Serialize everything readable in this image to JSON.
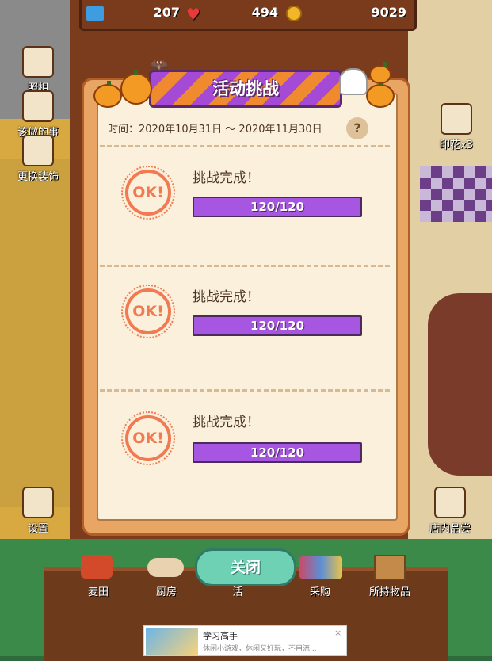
{
  "topbar": {
    "tickets": "207",
    "hearts": "494",
    "coins": "9029"
  },
  "left_menu": {
    "photo": "照相",
    "todo": "该做的事",
    "decor": "更换装饰",
    "settings": "设置"
  },
  "right_menu": {
    "stamp": "印花x3",
    "tasting": "店内品尝"
  },
  "dialog": {
    "title": "活动挑战",
    "period_label": "时间：2020年10月31日 ～ 2020年11月30日",
    "help": "?",
    "tasks": [
      {
        "badge": "OK!",
        "title": "挑战完成！",
        "progress_text": "120/120",
        "progress": 1.0
      },
      {
        "badge": "OK!",
        "title": "挑战完成！",
        "progress_text": "120/120",
        "progress": 1.0
      },
      {
        "badge": "OK!",
        "title": "挑战完成！",
        "progress_text": "120/120",
        "progress": 1.0
      }
    ]
  },
  "close_label": "关闭",
  "bottom_nav": {
    "field": "麦田",
    "kitchen": "厨房",
    "shop": "活",
    "purchase": "采购",
    "items": "所持物品"
  },
  "ad": {
    "title": "学习高手",
    "desc": "休闲小游戏，休闲又好玩，不用流...",
    "close": "×"
  },
  "colors": {
    "accent_purple": "#a656e0",
    "ok_orange": "#f07a52",
    "close_teal": "#6ed1b4"
  }
}
